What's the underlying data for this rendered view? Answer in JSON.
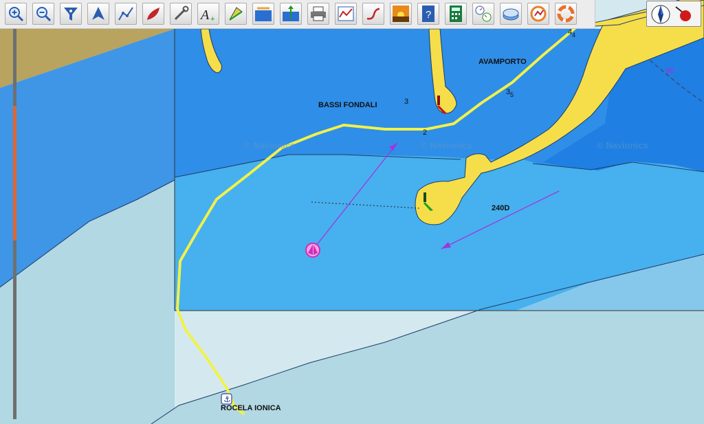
{
  "toolbar": {
    "buttons": [
      {
        "id": "zoom-in",
        "icon": "zoom-in-icon"
      },
      {
        "id": "zoom-out",
        "icon": "zoom-out-icon"
      },
      {
        "id": "funnel",
        "icon": "funnel-icon"
      },
      {
        "id": "waypoint",
        "icon": "waypoint-icon"
      },
      {
        "id": "route",
        "icon": "route-icon"
      },
      {
        "id": "boat",
        "icon": "boat-icon"
      },
      {
        "id": "tools",
        "icon": "wrench-icon"
      },
      {
        "id": "add-text",
        "icon": "add-text-icon"
      },
      {
        "id": "tide",
        "icon": "tide-icon"
      },
      {
        "id": "range",
        "icon": "range-icon"
      },
      {
        "id": "depth",
        "icon": "depth-icon"
      },
      {
        "id": "print",
        "icon": "printer-icon"
      },
      {
        "id": "graph",
        "icon": "graph-icon"
      },
      {
        "id": "track",
        "icon": "track-icon"
      },
      {
        "id": "sunset",
        "icon": "sunset-icon"
      },
      {
        "id": "help",
        "icon": "help-book-icon"
      },
      {
        "id": "calculator",
        "icon": "calculator-icon"
      },
      {
        "id": "instruments",
        "icon": "gauges-icon"
      },
      {
        "id": "gps",
        "icon": "gps-icon"
      },
      {
        "id": "weather",
        "icon": "weather-icon"
      },
      {
        "id": "lifebuoy",
        "icon": "lifebuoy-icon"
      }
    ]
  },
  "map": {
    "labels": {
      "avamporto": "AVAMPORTO",
      "bassi_fondali": "BASSI FONDALI",
      "rocela_ionica": "ROCELA IONICA",
      "course": "240D"
    },
    "depths": {
      "d1": "3",
      "d2": "2",
      "d3": "3",
      "d3_sub": "5",
      "d4": "4",
      "d4_sub": "4"
    },
    "watermarks": [
      "© Navionics",
      "© Navionics",
      "© Navionics"
    ],
    "colors": {
      "land": "#b8a35f",
      "deep_water": "#3f95e6",
      "mid_water": "#47b0ee",
      "shallow_water": "#b1d8e3",
      "dry": "#d4e9ef",
      "breakwater": "#f5de4a",
      "route": "#f1f14a",
      "vector": "#a035e0",
      "boat": "#e03ac8"
    }
  },
  "scrollbar": {
    "position_fraction": 0.3
  }
}
